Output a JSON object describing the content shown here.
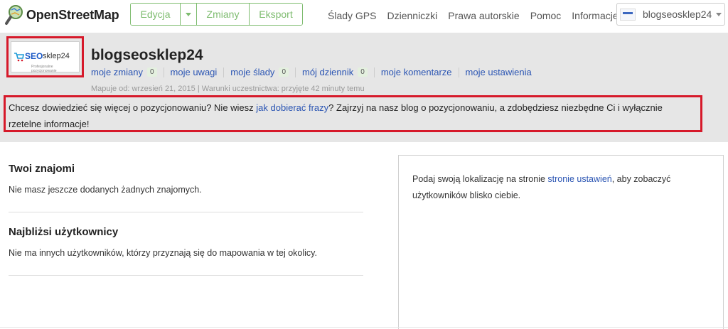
{
  "header": {
    "brand": "OpenStreetMap",
    "edit_group": {
      "edit_label": "Edycja",
      "changes_label": "Zmiany",
      "export_label": "Eksport"
    },
    "nav": [
      "Ślady GPS",
      "Dzienniczki",
      "Prawa autorskie",
      "Pomoc",
      "Informacje"
    ],
    "user_menu": {
      "username": "blogseosklep24"
    }
  },
  "profile": {
    "avatar": {
      "brand_a": "SEO",
      "brand_b": "sklep24",
      "tagline": "Profesjonalne pozycjonowanie"
    },
    "name": "blogseosklep24",
    "links": [
      {
        "label": "moje zmiany",
        "count": "0"
      },
      {
        "label": "moje uwagi"
      },
      {
        "label": "moje ślady",
        "count": "0"
      },
      {
        "label": "mój dziennik",
        "count": "0"
      },
      {
        "label": "moje komentarze"
      },
      {
        "label": "moje ustawienia"
      }
    ],
    "meta": "Mapuje od: wrzesień 21, 2015 | Warunki uczestnictwa: przyjęte 42 minuty temu",
    "description": {
      "before": "Chcesz dowiedzieć się więcej o pozycjonowaniu? Nie wiesz ",
      "link": "jak dobierać frazy",
      "after": "? Zajrzyj na nasz blog o pozycjonowaniu, a zdobędziesz niezbędne Ci i wyłącznie rzetelne informacje!"
    }
  },
  "friends": {
    "title": "Twoi znajomi",
    "text": "Nie masz jeszcze dodanych żadnych znajomych."
  },
  "nearby": {
    "title": "Najbliżsi użytkownicy",
    "text": "Nie ma innych użytkowników, którzy przyznają się do mapowania w tej okolicy."
  },
  "location_card": {
    "before": "Podaj swoją lokalizację na stronie ",
    "link": "stronie ustawień",
    "after": ", aby zobaczyć użytkowników blisko ciebie."
  },
  "colors": {
    "osm_green": "#7ebc6f",
    "link_blue": "#2b55b3",
    "highlight_red": "#d6192a",
    "band_gray": "#e6e6e6"
  }
}
